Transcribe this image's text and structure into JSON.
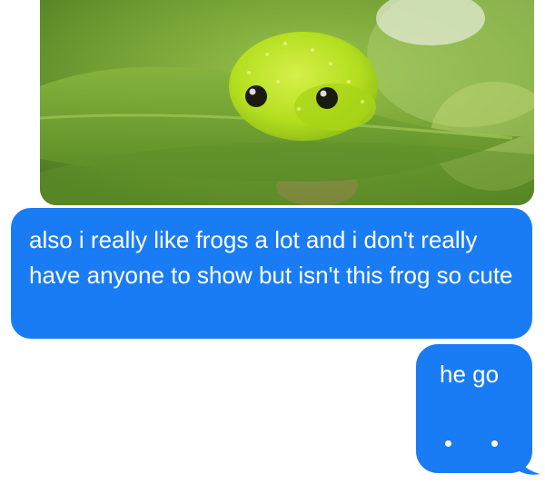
{
  "conversation": {
    "attachment": {
      "subject": "frog-photo",
      "colors": {
        "leaf": "#76a535",
        "frog": "#b3de1e",
        "eye": "#1b1b10"
      }
    },
    "messages": [
      {
        "side": "left",
        "text": "also i really like frogs a lot and i don't really have anyone to show but isn't this frog so cute"
      },
      {
        "side": "right",
        "text": "he go",
        "trailing_icon": "ellipsis-dots"
      }
    ],
    "colors": {
      "bubble": "#1a7cf5",
      "bubble_text": "#ffffff",
      "background": "#ffffff"
    }
  }
}
